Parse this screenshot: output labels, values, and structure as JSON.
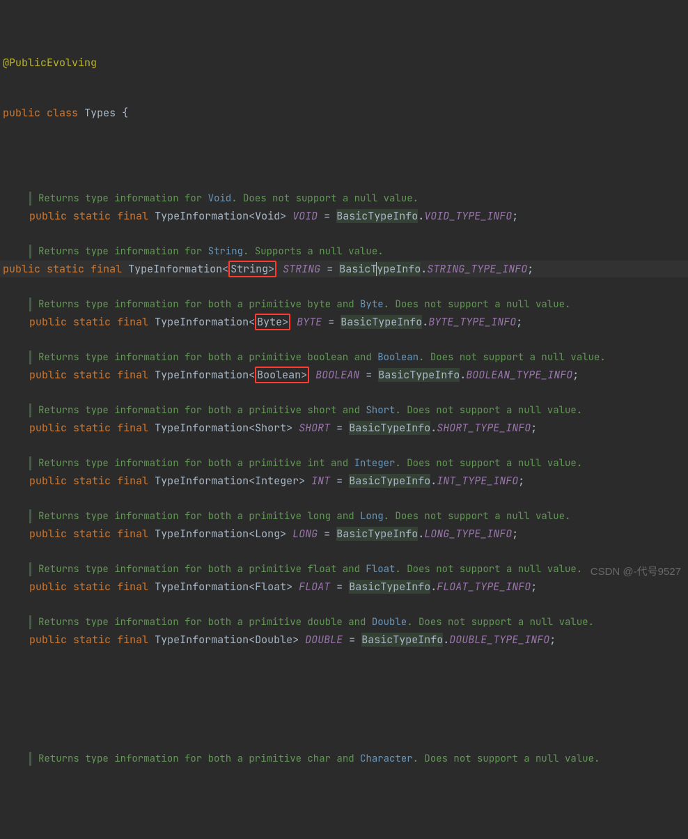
{
  "header": {
    "annotation": "@PublicEvolving",
    "decl_public": "public",
    "decl_class": "class",
    "decl_name": "Types",
    "decl_brace": " {"
  },
  "kw": {
    "public": "public",
    "static": "static",
    "final": "final"
  },
  "typeinfo": "TypeInformation",
  "basictypeinfo": "BasicTypeInfo",
  "entries": [
    {
      "doc_pre": "Returns type information for ",
      "doc_link": "Void",
      "doc_post": ". Does not support a null value.",
      "generic": "Void",
      "const_name": "VOID",
      "rhs_const": "VOID_TYPE_INFO",
      "redbox": false,
      "highlight": false
    },
    {
      "doc_pre": "Returns type information for ",
      "doc_link": "String",
      "doc_post": ". Supports a null value.",
      "generic": "String",
      "const_name": "STRING",
      "rhs_const": "STRING_TYPE_INFO",
      "redbox": true,
      "highlight": true
    },
    {
      "doc_pre": "Returns type information for both a primitive ",
      "doc_prim": "byte",
      "doc_mid": " and ",
      "doc_link": "Byte",
      "doc_post": ". Does not support a null value.",
      "generic": "Byte",
      "const_name": "BYTE",
      "rhs_const": "BYTE_TYPE_INFO",
      "redbox": true,
      "highlight": false
    },
    {
      "doc_pre": "Returns type information for both a primitive ",
      "doc_prim": "boolean",
      "doc_mid": " and ",
      "doc_link": "Boolean",
      "doc_post": ". Does not support a null value.",
      "generic": "Boolean",
      "const_name": "BOOLEAN",
      "rhs_const": "BOOLEAN_TYPE_INFO",
      "redbox": true,
      "highlight": false
    },
    {
      "doc_pre": "Returns type information for both a primitive ",
      "doc_prim": "short",
      "doc_mid": " and ",
      "doc_link": "Short",
      "doc_post": ". Does not support a null value.",
      "generic": "Short",
      "const_name": "SHORT",
      "rhs_const": "SHORT_TYPE_INFO",
      "redbox": false,
      "highlight": false
    },
    {
      "doc_pre": "Returns type information for both a primitive ",
      "doc_prim": "int",
      "doc_mid": " and ",
      "doc_link": "Integer",
      "doc_post": ". Does not support a null value.",
      "generic": "Integer",
      "const_name": "INT",
      "rhs_const": "INT_TYPE_INFO",
      "redbox": false,
      "highlight": false
    },
    {
      "doc_pre": "Returns type information for both a primitive ",
      "doc_prim": "long",
      "doc_mid": " and ",
      "doc_link": "Long",
      "doc_post": ". Does not support a null value.",
      "generic": "Long",
      "const_name": "LONG",
      "rhs_const": "LONG_TYPE_INFO",
      "redbox": false,
      "highlight": false
    },
    {
      "doc_pre": "Returns type information for both a primitive ",
      "doc_prim": "float",
      "doc_mid": " and ",
      "doc_link": "Float",
      "doc_post": ". Does not support a null value.",
      "generic": "Float",
      "const_name": "FLOAT",
      "rhs_const": "FLOAT_TYPE_INFO",
      "redbox": false,
      "highlight": false
    },
    {
      "doc_pre": "Returns type information for both a primitive ",
      "doc_prim": "double",
      "doc_mid": " and ",
      "doc_link": "Double",
      "doc_post": ". Does not support a null value.",
      "generic": "Double",
      "const_name": "DOUBLE",
      "rhs_const": "DOUBLE_TYPE_INFO",
      "redbox": false,
      "highlight": false
    }
  ],
  "tail_doc": {
    "pre": "Returns type information for both a primitive ",
    "prim": "char",
    "mid": " and ",
    "link": "Character",
    "post": ". Does not support a null value."
  },
  "watermark": "CSDN @-代号9527"
}
